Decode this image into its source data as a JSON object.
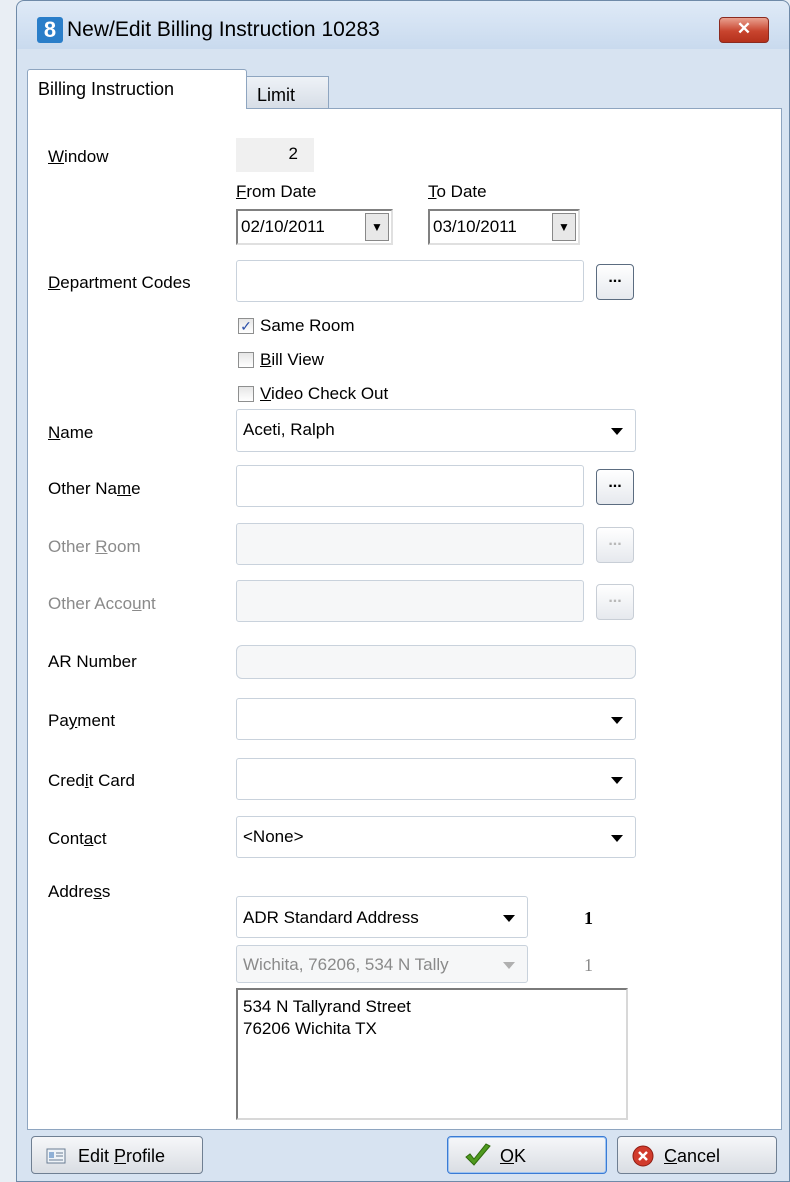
{
  "window": {
    "title": "New/Edit Billing Instruction  10283",
    "app_icon": "8",
    "close_glyph": "✕"
  },
  "tabs": [
    {
      "label": "Billing Instruction",
      "active": true
    },
    {
      "label": "Limit",
      "active": false
    }
  ],
  "form": {
    "window_label": "Window",
    "window_value": "2",
    "from_date_label": "From Date",
    "from_date_value": "02/10/2011",
    "to_date_label": "To Date",
    "to_date_value": "03/10/2011",
    "department_codes_label": "Department Codes",
    "department_codes_value": "",
    "same_room": {
      "label": "Same Room",
      "checked": true
    },
    "bill_view": {
      "label": "Bill View",
      "checked": false
    },
    "video_check_out": {
      "label": "Video Check Out",
      "checked": false
    },
    "name_label": "Name",
    "name_value": "Aceti, Ralph",
    "other_name_label": "Other Name",
    "other_name_value": "",
    "other_room_label": "Other Room",
    "other_room_value": "",
    "other_account_label": "Other Account",
    "other_account_value": "",
    "ar_number_label": "AR Number",
    "ar_number_value": "",
    "payment_label": "Payment",
    "payment_value": "",
    "credit_card_label": "Credit Card",
    "credit_card_value": "",
    "contact_label": "Contact",
    "contact_value": "<None>",
    "address_label": "Address",
    "address_type_value": "ADR  Standard Address",
    "address_type_count": "1",
    "address_line_value": "Wichita, 76206, 534 N Tally",
    "address_line_count": "1",
    "address_text_line1": "534 N Tallyrand Street",
    "address_text_line2": "76206 Wichita TX",
    "ellipsis_glyph": "..."
  },
  "buttons": {
    "edit_profile": "Edit Profile",
    "ok": "OK",
    "cancel": "Cancel"
  }
}
